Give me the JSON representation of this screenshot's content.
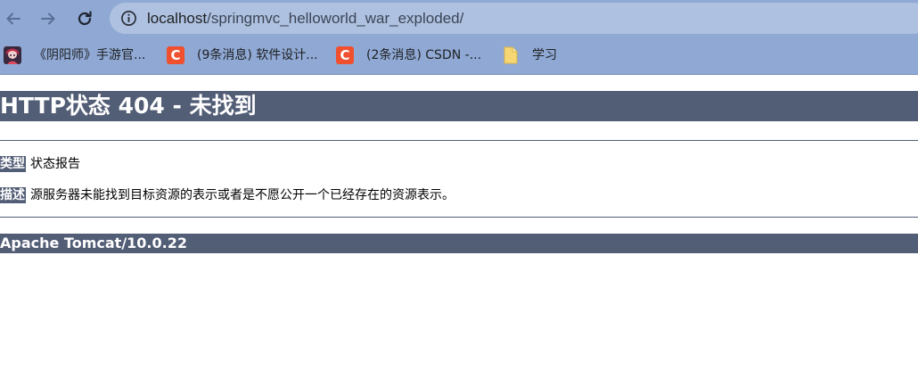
{
  "browser": {
    "url_host": "localhost",
    "url_path": "/springmvc_helloworld_war_exploded/",
    "icons": {
      "back": "arrow-left-icon",
      "forward": "arrow-right-icon",
      "reload": "reload-icon",
      "site_info": "info-icon"
    },
    "colors": {
      "toolbar": "#8fa9d4",
      "omnibox": "#aec1e0"
    }
  },
  "bookmarks": [
    {
      "label": "《阴阳师》手游官...",
      "icon": "onmyoji-favicon"
    },
    {
      "label": "(9条消息) 软件设计...",
      "icon": "csdn-favicon",
      "icon_letter": "C"
    },
    {
      "label": "(2条消息) CSDN -...",
      "icon": "csdn-favicon",
      "icon_letter": "C"
    },
    {
      "label": "学习",
      "icon": "folder-icon"
    }
  ],
  "error_page": {
    "title": "HTTP状态 404 - 未找到",
    "type_label": "类型",
    "type_value": "状态报告",
    "description_label": "描述",
    "description_value": "源服务器未能找到目标资源的表示或者是不愿公开一个已经存在的资源表示。",
    "footer": "Apache Tomcat/10.0.22",
    "colors": {
      "bar": "#525d76",
      "text_on_bar": "#ffffff"
    }
  }
}
